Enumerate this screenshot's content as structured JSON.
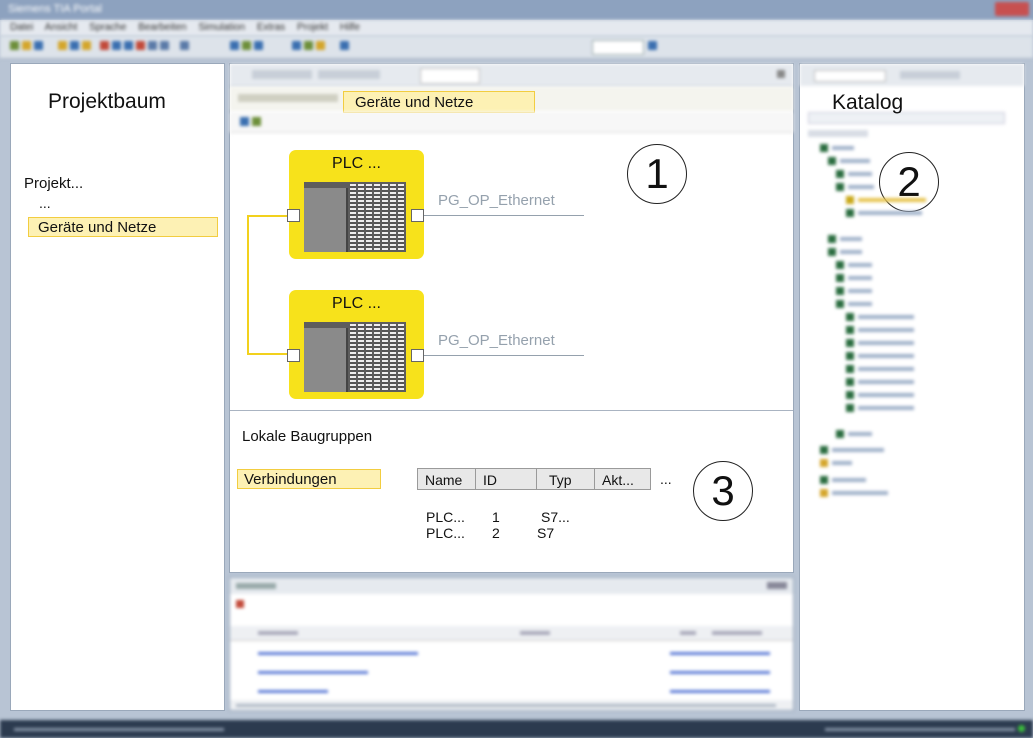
{
  "window": {
    "title": "Siemens TIA Portal"
  },
  "menubar": {
    "items": [
      "Datei",
      "Ansicht",
      "Sprache",
      "Bearbeiten",
      "Simulation",
      "Extras",
      "Projekt",
      "Hilfe"
    ]
  },
  "project_tree": {
    "title": "Projektbaum",
    "root": "Projekt...",
    "ellipsis": "...",
    "devices_networks": "Geräte und Netze"
  },
  "center": {
    "sub_label": "Geräte und Netze",
    "marker_1": "1",
    "plc1": {
      "label": "PLC ...",
      "network": "PG_OP_Ethernet"
    },
    "plc2": {
      "label": "PLC ...",
      "network": "PG_OP_Ethernet"
    },
    "local_modules": "Lokale Baugruppen",
    "connections": "Verbindungen",
    "marker_3": "3",
    "table": {
      "headers": [
        "Name",
        "ID",
        "Typ",
        "Akt..."
      ],
      "more": "...",
      "rows": [
        [
          "PLC...",
          "1",
          "S7..."
        ],
        [
          "PLC...",
          "2",
          "S7"
        ]
      ]
    }
  },
  "catalog": {
    "title": "Katalog",
    "marker_2": "2"
  },
  "colors": {
    "highlight_fill": "#fdf1b4",
    "highlight_border": "#f2cd40",
    "plc_yellow": "#f7e21b",
    "network_gray": "#95a1ad",
    "statusbar": "#2c3b4f"
  }
}
